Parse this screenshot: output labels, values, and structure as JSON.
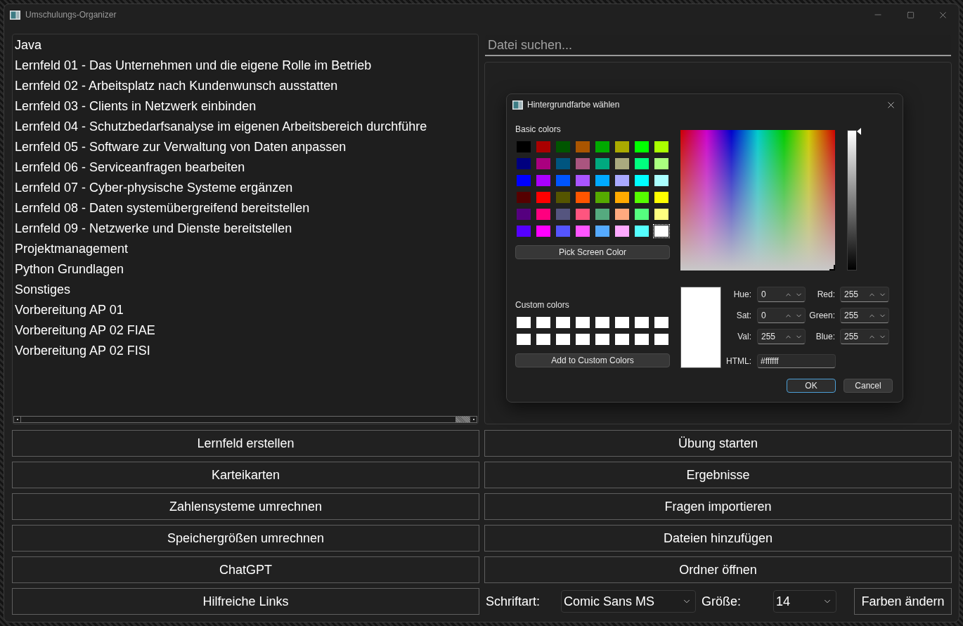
{
  "window": {
    "title": "Umschulungs-Organizer"
  },
  "file_list": {
    "items": [
      {
        "label": "Java",
        "selected": false
      },
      {
        "label": "Lernfeld 01 - Das Unternehmen und die eigene Rolle im Betrieb",
        "selected": false
      },
      {
        "label": "Lernfeld 02 - Arbeitsplatz nach Kundenwunsch ausstatten",
        "selected": false
      },
      {
        "label": "Lernfeld 03 - Clients in Netzwerk einbinden",
        "selected": false
      },
      {
        "label": "Lernfeld 04 - Schutzbedarfsanalyse im eigenen Arbeitsbereich durchführe",
        "selected": false
      },
      {
        "label": "Lernfeld 05 - Software zur Verwaltung von Daten anpassen",
        "selected": false
      },
      {
        "label": "Lernfeld 06 - Serviceanfragen bearbeiten",
        "selected": false
      },
      {
        "label": "Lernfeld 07 - Cyber-physische Systeme ergänzen",
        "selected": false
      },
      {
        "label": "Lernfeld 08 - Daten systemübergreifend bereitstellen",
        "selected": false
      },
      {
        "label": "Lernfeld 09 - Netzwerke und Dienste bereitstellen",
        "selected": false
      },
      {
        "label": "Projektmanagement",
        "selected": false
      },
      {
        "label": "Python Grundlagen",
        "selected": false
      },
      {
        "label": "Sonstiges",
        "selected": false
      },
      {
        "label": "Vorbereitung AP 01",
        "selected": false
      },
      {
        "label": "Vorbereitung AP 02 FIAE",
        "selected": false
      },
      {
        "label": "Vorbereitung AP 02 FISI",
        "selected": false
      }
    ]
  },
  "search": {
    "placeholder": "Datei suchen..."
  },
  "left_buttons": [
    "Lernfeld erstellen",
    "Karteikarten",
    "Zahlensysteme umrechnen",
    "Speichergrößen umrechnen",
    "ChatGPT",
    "Hilfreiche Links"
  ],
  "right_buttons": [
    "Übung starten",
    "Ergebnisse",
    "Fragen importieren",
    "Dateien hinzufügen",
    "Ordner öffnen"
  ],
  "font_settings": {
    "font_label": "Schriftart:",
    "font": "Comic Sans MS",
    "size_label": "Größe:",
    "size": "14",
    "colors_button": "Farben ändern"
  },
  "color_dialog": {
    "title": "Hintergrundfarbe wählen",
    "basic_colors_label": "Basic colors",
    "basic_colors": [
      {
        "color": "#000000",
        "selected": false
      },
      {
        "color": "#aa0000",
        "selected": false
      },
      {
        "color": "#005500",
        "selected": false
      },
      {
        "color": "#aa5500",
        "selected": false
      },
      {
        "color": "#00aa00",
        "selected": false
      },
      {
        "color": "#aaaa00",
        "selected": false
      },
      {
        "color": "#00ff00",
        "selected": false
      },
      {
        "color": "#aaff00",
        "selected": false
      },
      {
        "color": "#00007f",
        "selected": false
      },
      {
        "color": "#aa007f",
        "selected": false
      },
      {
        "color": "#00557f",
        "selected": false
      },
      {
        "color": "#aa557f",
        "selected": false
      },
      {
        "color": "#00aa7f",
        "selected": false
      },
      {
        "color": "#aaaa7f",
        "selected": false
      },
      {
        "color": "#00ff7f",
        "selected": false
      },
      {
        "color": "#aaff7f",
        "selected": false
      },
      {
        "color": "#0000ff",
        "selected": false
      },
      {
        "color": "#aa00ff",
        "selected": false
      },
      {
        "color": "#0055ff",
        "selected": false
      },
      {
        "color": "#aa55ff",
        "selected": false
      },
      {
        "color": "#00aaff",
        "selected": false
      },
      {
        "color": "#aaaaff",
        "selected": false
      },
      {
        "color": "#00ffff",
        "selected": false
      },
      {
        "color": "#aaffff",
        "selected": false
      },
      {
        "color": "#550000",
        "selected": false
      },
      {
        "color": "#ff0000",
        "selected": false
      },
      {
        "color": "#555500",
        "selected": false
      },
      {
        "color": "#ff5500",
        "selected": false
      },
      {
        "color": "#55aa00",
        "selected": false
      },
      {
        "color": "#ffaa00",
        "selected": false
      },
      {
        "color": "#55ff00",
        "selected": false
      },
      {
        "color": "#ffff00",
        "selected": false
      },
      {
        "color": "#55007f",
        "selected": false
      },
      {
        "color": "#ff007f",
        "selected": false
      },
      {
        "color": "#55557f",
        "selected": false
      },
      {
        "color": "#ff557f",
        "selected": false
      },
      {
        "color": "#55aa7f",
        "selected": false
      },
      {
        "color": "#ffaa7f",
        "selected": false
      },
      {
        "color": "#55ff7f",
        "selected": false
      },
      {
        "color": "#ffff7f",
        "selected": false
      },
      {
        "color": "#5500ff",
        "selected": false
      },
      {
        "color": "#ff00ff",
        "selected": false
      },
      {
        "color": "#5555ff",
        "selected": false
      },
      {
        "color": "#ff55ff",
        "selected": false
      },
      {
        "color": "#55aaff",
        "selected": false
      },
      {
        "color": "#ffaaff",
        "selected": false
      },
      {
        "color": "#55ffff",
        "selected": false
      },
      {
        "color": "#ffffff",
        "selected": true
      }
    ],
    "pick_screen_color_button": "Pick Screen Color",
    "custom_colors_label": "Custom colors",
    "custom_colors": [
      {
        "color": "#ffffff",
        "selected": false
      },
      {
        "color": "#ffffff",
        "selected": false
      },
      {
        "color": "#ffffff",
        "selected": false
      },
      {
        "color": "#ffffff",
        "selected": false
      },
      {
        "color": "#ffffff",
        "selected": false
      },
      {
        "color": "#ffffff",
        "selected": false
      },
      {
        "color": "#ffffff",
        "selected": false
      },
      {
        "color": "#ffffff",
        "selected": false
      },
      {
        "color": "#ffffff",
        "selected": false
      },
      {
        "color": "#ffffff",
        "selected": false
      },
      {
        "color": "#ffffff",
        "selected": false
      },
      {
        "color": "#ffffff",
        "selected": false
      },
      {
        "color": "#ffffff",
        "selected": false
      },
      {
        "color": "#ffffff",
        "selected": false
      },
      {
        "color": "#ffffff",
        "selected": false
      },
      {
        "color": "#ffffff",
        "selected": false
      }
    ],
    "add_custom_button": "Add to Custom Colors",
    "value_slider": {
      "level": 1
    },
    "hsv_fields": [
      {
        "label": "Hue:",
        "value": "0"
      },
      {
        "label": "Sat:",
        "value": "0"
      },
      {
        "label": "Val:",
        "value": "255"
      }
    ],
    "rgb_fields": [
      {
        "label": "Red:",
        "value": "255"
      },
      {
        "label": "Green:",
        "value": "255"
      },
      {
        "label": "Blue:",
        "value": "255"
      }
    ],
    "html_field": {
      "label": "HTML:",
      "value": "#ffffff"
    },
    "buttons": [
      {
        "label": "OK",
        "default": true
      },
      {
        "label": "Cancel",
        "default": false
      }
    ]
  }
}
